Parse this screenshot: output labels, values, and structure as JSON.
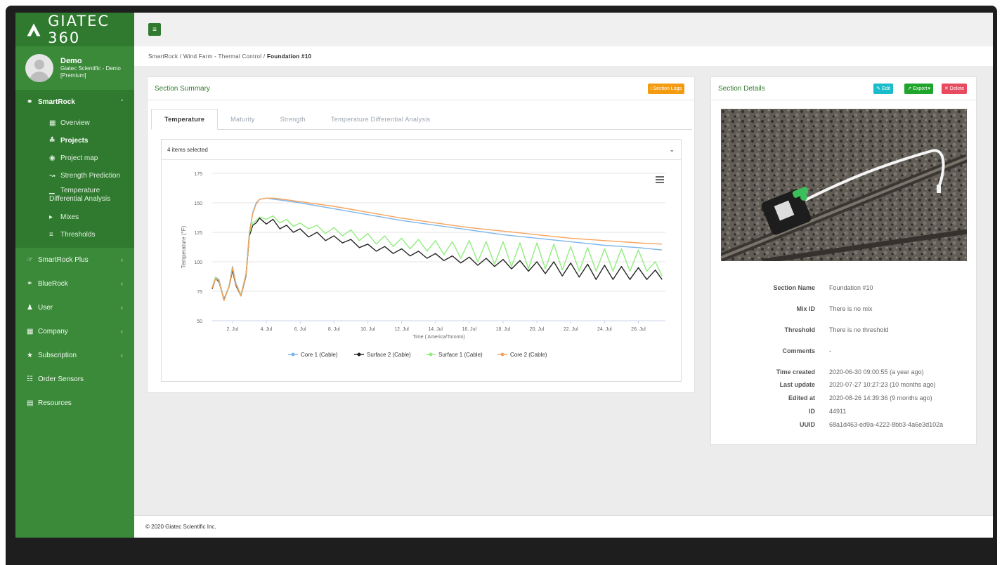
{
  "app": {
    "logo_text": "GIATEC 360",
    "brand_color": "#3b8a3a",
    "brand_dark": "#2f7a2e"
  },
  "user": {
    "name": "Demo",
    "org_line1": "Giatec Scientific - Demo",
    "org_line2": "[Premium]"
  },
  "sidebar": {
    "smartrock": {
      "label": "SmartRock",
      "icon": "wifi-icon"
    },
    "sub_items": [
      {
        "label": "Overview",
        "icon": "dashboard-icon"
      },
      {
        "label": "Projects",
        "icon": "projects-icon"
      },
      {
        "label": "Project map",
        "icon": "globe-icon"
      },
      {
        "label": "Strength Prediction",
        "icon": "line-chart-icon"
      },
      {
        "label_line1": "Temperature",
        "label_line2": "Differential Analysis",
        "icon": "bar-chart-icon"
      },
      {
        "label": "Mixes",
        "icon": "truck-icon"
      },
      {
        "label": "Thresholds",
        "icon": "sliders-icon"
      }
    ],
    "main_items": [
      {
        "label": "SmartRock Plus",
        "icon": "handshake-icon"
      },
      {
        "label": "BlueRock",
        "icon": "wifi-icon"
      },
      {
        "label": "User",
        "icon": "user-icon"
      },
      {
        "label": "Company",
        "icon": "building-icon"
      },
      {
        "label": "Subscription",
        "icon": "star-icon"
      },
      {
        "label": "Order Sensors",
        "icon": "cart-icon"
      },
      {
        "label": "Resources",
        "icon": "folder-icon"
      }
    ]
  },
  "breadcrumb": {
    "path": "SmartRock / Wind Farm - Thermal Control / ",
    "current": "Foundation #10"
  },
  "summary": {
    "title": "Section Summary",
    "logs_button": "Section Logs",
    "tabs": [
      "Temperature",
      "Maturity",
      "Strength",
      "Temperature Differential Analysis"
    ],
    "select_text": "4 items selected"
  },
  "chart_data": {
    "type": "line",
    "ylabel": "Temperature (°F)",
    "xlabel": "Time ( America/Toronto)",
    "ylim": [
      50,
      175
    ],
    "yticks": [
      50,
      75,
      100,
      125,
      150,
      175
    ],
    "x_tick_labels": [
      "2. Jul",
      "4. Jul",
      "6. Jul",
      "8. Jul",
      "10. Jul",
      "12. Jul",
      "14. Jul",
      "16. Jul",
      "18. Jul",
      "20. Jul",
      "22. Jul",
      "24. Jul",
      "26. Jul"
    ],
    "x_tick_days": [
      2,
      4,
      6,
      8,
      10,
      12,
      14,
      16,
      18,
      20,
      22,
      24,
      26
    ],
    "x_range_days": [
      0.8,
      27.6
    ],
    "legend_position": "bottom",
    "series": [
      {
        "name": "Core 1 (Cable)",
        "color": "#7cb5ec",
        "x": [
          0.8,
          1.0,
          1.2,
          1.5,
          1.8,
          2.0,
          2.2,
          2.5,
          2.8,
          3.0,
          3.2,
          3.4,
          3.6,
          4.0,
          4.5,
          5.0,
          6,
          8,
          10,
          12,
          14,
          16,
          18,
          20,
          22,
          24,
          26,
          27.4
        ],
        "y": [
          78,
          87,
          85,
          68,
          80,
          96,
          82,
          72,
          90,
          125,
          142,
          150,
          153,
          154,
          153,
          152,
          150,
          145,
          140,
          135,
          131,
          127,
          123,
          120,
          117,
          114,
          112,
          110
        ]
      },
      {
        "name": "Surface 2 (Cable)",
        "color": "#222222",
        "x": [
          0.8,
          1.0,
          1.2,
          1.5,
          1.8,
          2.0,
          2.2,
          2.5,
          2.8,
          3.0,
          3.2,
          3.4,
          3.6,
          4.0,
          4.4,
          4.8,
          5.2,
          5.6,
          6.0,
          6.5,
          7.0,
          7.5,
          8.0,
          8.5,
          9.0,
          9.5,
          10,
          10.5,
          11,
          11.5,
          12,
          12.5,
          13,
          13.5,
          14,
          14.5,
          15,
          15.5,
          16,
          16.5,
          17,
          17.5,
          18,
          18.5,
          19,
          19.5,
          20,
          20.5,
          21,
          21.5,
          22,
          22.5,
          23,
          23.5,
          24,
          24.5,
          25,
          25.5,
          26,
          26.5,
          27,
          27.4
        ],
        "y": [
          77,
          86,
          83,
          68,
          79,
          93,
          80,
          71,
          88,
          122,
          131,
          133,
          137,
          132,
          136,
          128,
          131,
          125,
          128,
          121,
          125,
          118,
          122,
          116,
          119,
          112,
          115,
          109,
          113,
          107,
          111,
          105,
          109,
          103,
          107,
          101,
          105,
          99,
          104,
          97,
          103,
          96,
          102,
          94,
          101,
          92,
          100,
          90,
          100,
          88,
          99,
          87,
          98,
          85,
          97,
          85,
          96,
          85,
          95,
          85,
          93,
          85
        ]
      },
      {
        "name": "Surface 1 (Cable)",
        "color": "#90ed7d",
        "x": [
          0.8,
          1.0,
          1.2,
          1.5,
          1.8,
          2.0,
          2.2,
          2.5,
          2.8,
          3.0,
          3.2,
          3.4,
          3.6,
          4.0,
          4.4,
          4.8,
          5.2,
          5.6,
          6.0,
          6.5,
          7.0,
          7.5,
          8.0,
          8.5,
          9.0,
          9.5,
          10,
          10.5,
          11,
          11.5,
          12,
          12.5,
          13,
          13.5,
          14,
          14.5,
          15,
          15.5,
          16,
          16.5,
          17,
          17.5,
          18,
          18.5,
          19,
          19.5,
          20,
          20.5,
          21,
          21.5,
          22,
          22.5,
          23,
          23.5,
          24,
          24.5,
          25,
          25.5,
          26,
          26.5,
          27,
          27.4
        ],
        "y": [
          78,
          87,
          84,
          67,
          80,
          95,
          81,
          72,
          89,
          124,
          133,
          135,
          138,
          136,
          139,
          133,
          136,
          130,
          133,
          128,
          131,
          124,
          129,
          122,
          127,
          118,
          124,
          115,
          122,
          113,
          120,
          111,
          119,
          109,
          118,
          106,
          117,
          103,
          118,
          100,
          117,
          98,
          117,
          96,
          116,
          94,
          116,
          94,
          115,
          93,
          113,
          92,
          112,
          92,
          111,
          92,
          111,
          92,
          110,
          92,
          100,
          88
        ]
      },
      {
        "name": "Core 2 (Cable)",
        "color": "#f7a35c",
        "x": [
          0.8,
          1.0,
          1.2,
          1.5,
          1.8,
          2.0,
          2.2,
          2.5,
          2.8,
          3.0,
          3.2,
          3.4,
          3.6,
          4.0,
          4.5,
          5.0,
          6,
          8,
          10,
          12,
          14,
          16,
          18,
          20,
          22,
          24,
          26,
          27.4
        ],
        "y": [
          78,
          86,
          84,
          67,
          79,
          95,
          81,
          71,
          89,
          124,
          141,
          149,
          153,
          154,
          154,
          153,
          151,
          147,
          142,
          137,
          133,
          129,
          126,
          123,
          120,
          118,
          116,
          115
        ]
      }
    ]
  },
  "details": {
    "title": "Section Details",
    "edit_label": "Edit",
    "export_label": "Export",
    "delete_label": "Delete",
    "fields": [
      {
        "label": "Section Name",
        "value": "Foundation #10"
      },
      {
        "label": "Mix ID",
        "value": "There is no mix"
      },
      {
        "label": "Threshold",
        "value": "There is no threshold"
      },
      {
        "label": "Comments",
        "value": "-"
      },
      {
        "label": "Time created",
        "value": "2020-06-30 09:00:55 (a year ago)"
      },
      {
        "label": "Last update",
        "value": "2020-07-27 10:27:23 (10 months ago)"
      },
      {
        "label": "Edited at",
        "value": "2020-08-26 14:39:36 (9 months ago)"
      },
      {
        "label": "ID",
        "value": "44911"
      },
      {
        "label": "UUID",
        "value": "68a1d463-ed9a-4222-8bb3-4a6e3d102a"
      }
    ]
  },
  "footer": {
    "text": "© 2020 Giatec Scientific Inc."
  }
}
